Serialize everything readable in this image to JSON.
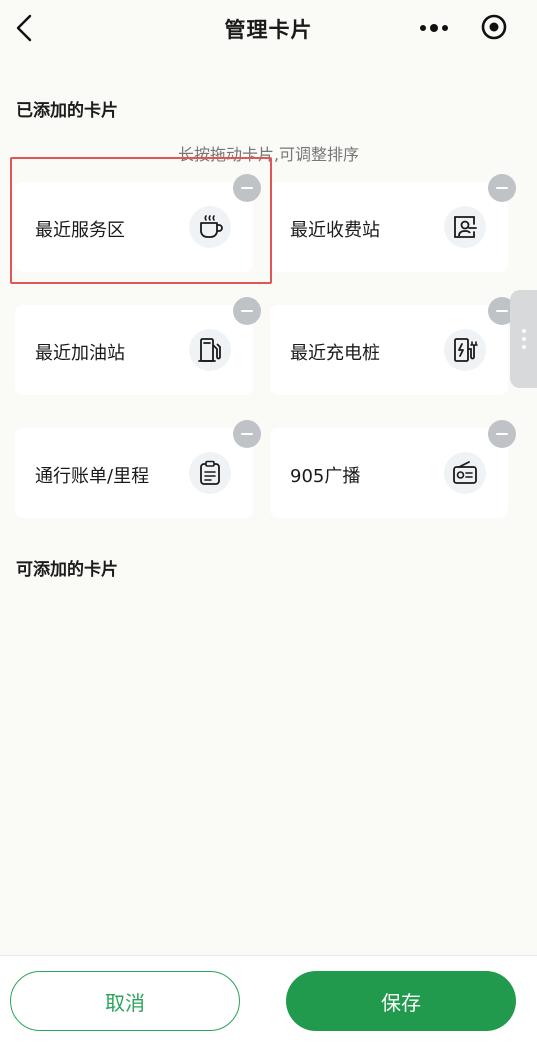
{
  "header": {
    "title": "管理卡片",
    "back_icon": "chevron-left-icon",
    "more_icon": "more-dots-icon",
    "target_icon": "target-icon"
  },
  "added_section": {
    "title": "已添加的卡片",
    "hint": "长按拖动卡片,可调整排序",
    "cards": [
      {
        "label": "最近服务区",
        "icon": "coffee-cup-icon"
      },
      {
        "label": "最近收费站",
        "icon": "toll-station-icon"
      },
      {
        "label": "最近加油站",
        "icon": "fuel-pump-icon"
      },
      {
        "label": "最近充电桩",
        "icon": "charging-station-icon"
      },
      {
        "label": "通行账单/里程",
        "icon": "bill-icon"
      },
      {
        "label": "905广播",
        "icon": "radio-icon"
      }
    ]
  },
  "available_section": {
    "title": "可添加的卡片"
  },
  "footer": {
    "cancel_label": "取消",
    "save_label": "保存"
  },
  "colors": {
    "accent": "#219a4e",
    "highlight": "#e25555",
    "background": "#fafaf7"
  }
}
